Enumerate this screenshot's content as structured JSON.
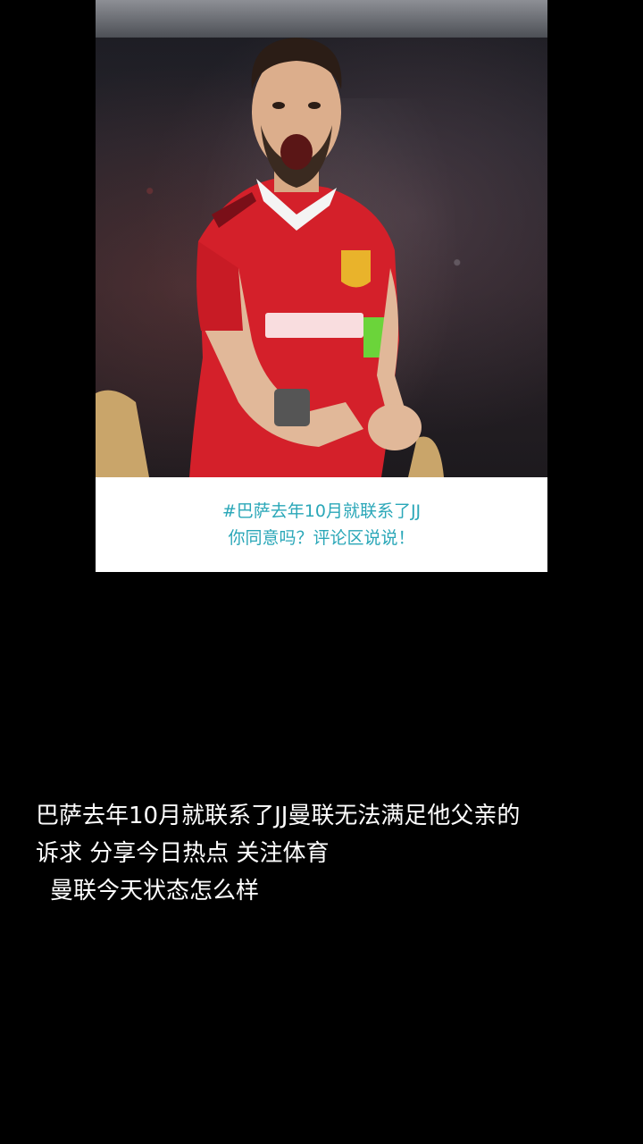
{
  "card": {
    "photo_alt": "",
    "caption_line1": "#巴萨去年10月就联系了JJ",
    "caption_line2": "你同意吗？评论区说说！"
  },
  "description": {
    "line1": "巴萨去年10月就联系了JJ曼联无法满足他父亲的",
    "line2": "诉求 分享今日热点 关注体育",
    "line3": "曼联今天状态怎么样"
  }
}
